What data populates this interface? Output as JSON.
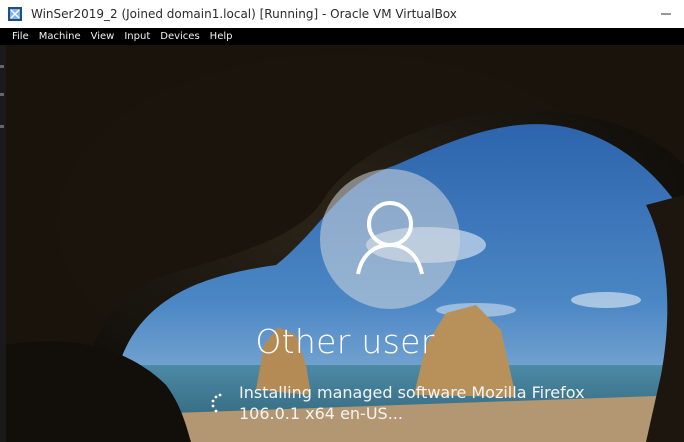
{
  "window": {
    "title": "WinSer2019_2 (Joined domain1.local) [Running] - Oracle VM VirtualBox",
    "app_icon": "virtualbox-icon",
    "controls": [
      "minimize-icon",
      "maximize-icon",
      "close-icon"
    ]
  },
  "menu": {
    "items": [
      {
        "label": "File"
      },
      {
        "label": "Machine"
      },
      {
        "label": "View"
      },
      {
        "label": "Input"
      },
      {
        "label": "Devices"
      },
      {
        "label": "Help"
      }
    ]
  },
  "vm_screen": {
    "avatar_icon": "user-icon",
    "username": "Other user",
    "status_line1": "Installing managed software Mozilla Firefox",
    "status_line2": "106.0.1 x64 en-US...",
    "spinner_icon": "loading-spinner-icon"
  },
  "colors": {
    "titlebar_bg": "#ffffff",
    "menubar_bg": "#000000",
    "sky": "#2f6fb6",
    "sea": "#3f7f9a",
    "text": "#ffffff"
  }
}
